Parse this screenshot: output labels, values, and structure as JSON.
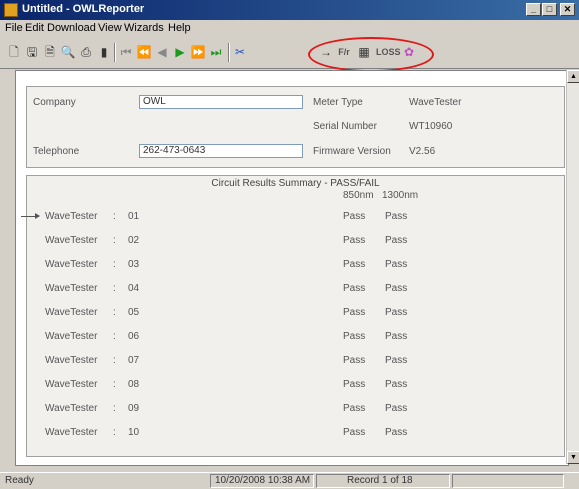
{
  "window": {
    "title": "Untitled - OWLReporter",
    "minimize": "_",
    "maximize": "□",
    "close": "✕"
  },
  "menu": [
    "File",
    "Edit",
    "Download",
    "View",
    "Wizards",
    "Help"
  ],
  "toolbar": {
    "fiber_label": "F/r",
    "loss_label": "LOSS"
  },
  "info": {
    "company_label": "Company",
    "company_value": "OWL",
    "telephone_label": "Telephone",
    "telephone_value": "262-473-0643",
    "meter_type_label": "Meter Type",
    "meter_type_value": "WaveTester",
    "serial_label": "Serial Number",
    "serial_value": "WT10960",
    "firmware_label": "Firmware Version",
    "firmware_value": "V2.56"
  },
  "summary": {
    "title": "Circuit Results Summary - PASS/FAIL",
    "col1": "850nm",
    "col2": "1300nm",
    "rows": [
      {
        "name": "WaveTester",
        "num": "01",
        "r1": "Pass",
        "r2": "Pass"
      },
      {
        "name": "WaveTester",
        "num": "02",
        "r1": "Pass",
        "r2": "Pass"
      },
      {
        "name": "WaveTester",
        "num": "03",
        "r1": "Pass",
        "r2": "Pass"
      },
      {
        "name": "WaveTester",
        "num": "04",
        "r1": "Pass",
        "r2": "Pass"
      },
      {
        "name": "WaveTester",
        "num": "05",
        "r1": "Pass",
        "r2": "Pass"
      },
      {
        "name": "WaveTester",
        "num": "06",
        "r1": "Pass",
        "r2": "Pass"
      },
      {
        "name": "WaveTester",
        "num": "07",
        "r1": "Pass",
        "r2": "Pass"
      },
      {
        "name": "WaveTester",
        "num": "08",
        "r1": "Pass",
        "r2": "Pass"
      },
      {
        "name": "WaveTester",
        "num": "09",
        "r1": "Pass",
        "r2": "Pass"
      },
      {
        "name": "WaveTester",
        "num": "10",
        "r1": "Pass",
        "r2": "Pass"
      }
    ]
  },
  "status": {
    "left": "Ready",
    "datetime": "10/20/2008 10:38 AM",
    "record": "Record 1 of 18"
  },
  "colors": {
    "title_bar": "#0a246a",
    "highlight_circle": "#e01818",
    "play_green": "#1a9a1a"
  }
}
